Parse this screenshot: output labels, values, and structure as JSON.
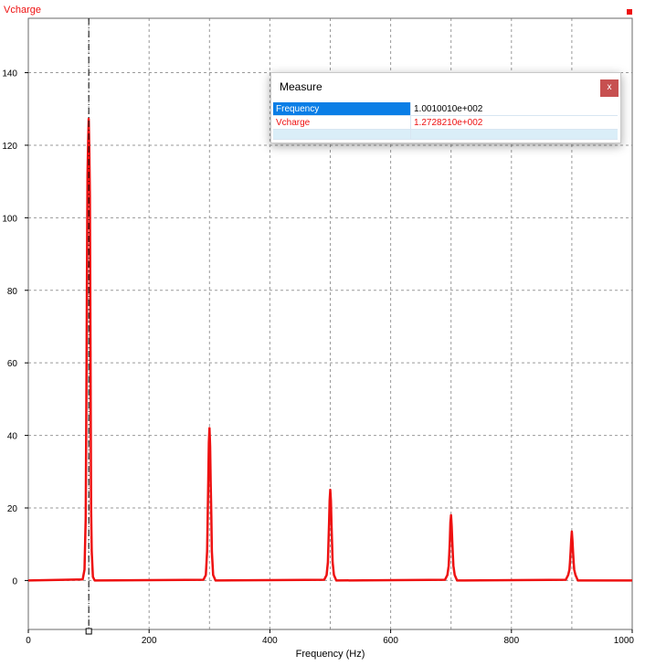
{
  "window": {
    "series_title": "Vcharge"
  },
  "measure": {
    "title": "Measure",
    "close_label": "x",
    "rows": [
      {
        "label": "Frequency",
        "value": "1.0010010e+002"
      },
      {
        "label": "Vcharge",
        "value": "1.2728210e+002"
      }
    ]
  },
  "colors": {
    "series": "#ee1111",
    "grid": "#9a9a9a",
    "selection": "#0a7ee6"
  },
  "chart_data": {
    "type": "line",
    "title": "Vcharge",
    "xlabel": "Frequency (Hz)",
    "ylabel": "",
    "xlim": [
      0,
      1000
    ],
    "ylim": [
      -13.5,
      155
    ],
    "grid": true,
    "xticks": [
      0,
      200,
      400,
      600,
      800,
      1000
    ],
    "yticks": [
      0,
      20,
      40,
      60,
      80,
      100,
      120,
      140
    ],
    "cursor_x": 100.1,
    "series": [
      {
        "name": "Vcharge",
        "color": "#ee1111",
        "x": [
          0,
          90,
          93,
          95,
          96,
          97,
          98,
          99,
          100,
          101,
          102,
          103,
          104,
          105,
          107,
          110,
          290,
          294,
          296,
          297,
          298,
          299,
          300,
          301,
          302,
          303,
          304,
          306,
          310,
          490,
          494,
          496,
          497,
          498,
          499,
          500,
          501,
          502,
          503,
          504,
          506,
          510,
          690,
          694,
          696,
          697,
          698,
          699,
          700,
          701,
          702,
          703,
          704,
          706,
          710,
          890,
          894,
          896,
          897,
          898,
          899,
          900,
          901,
          902,
          903,
          904,
          906,
          910,
          1000
        ],
        "y": [
          0,
          0.3,
          3,
          17,
          48,
          80,
          112,
          120,
          127.3,
          118,
          106,
          62,
          20,
          8,
          1,
          0,
          0.2,
          1.5,
          8,
          17,
          28,
          38,
          42,
          37,
          27,
          18,
          8,
          1.5,
          0,
          0.2,
          1.5,
          5,
          10,
          16,
          22,
          25,
          22,
          16,
          10,
          5,
          1.5,
          0,
          0.2,
          1.5,
          4,
          7,
          11,
          16,
          18,
          15,
          11,
          7,
          4,
          1.5,
          0,
          0.2,
          1.5,
          3,
          5,
          8,
          11,
          13.5,
          11,
          8,
          5,
          3,
          1.5,
          0,
          0
        ]
      }
    ]
  }
}
